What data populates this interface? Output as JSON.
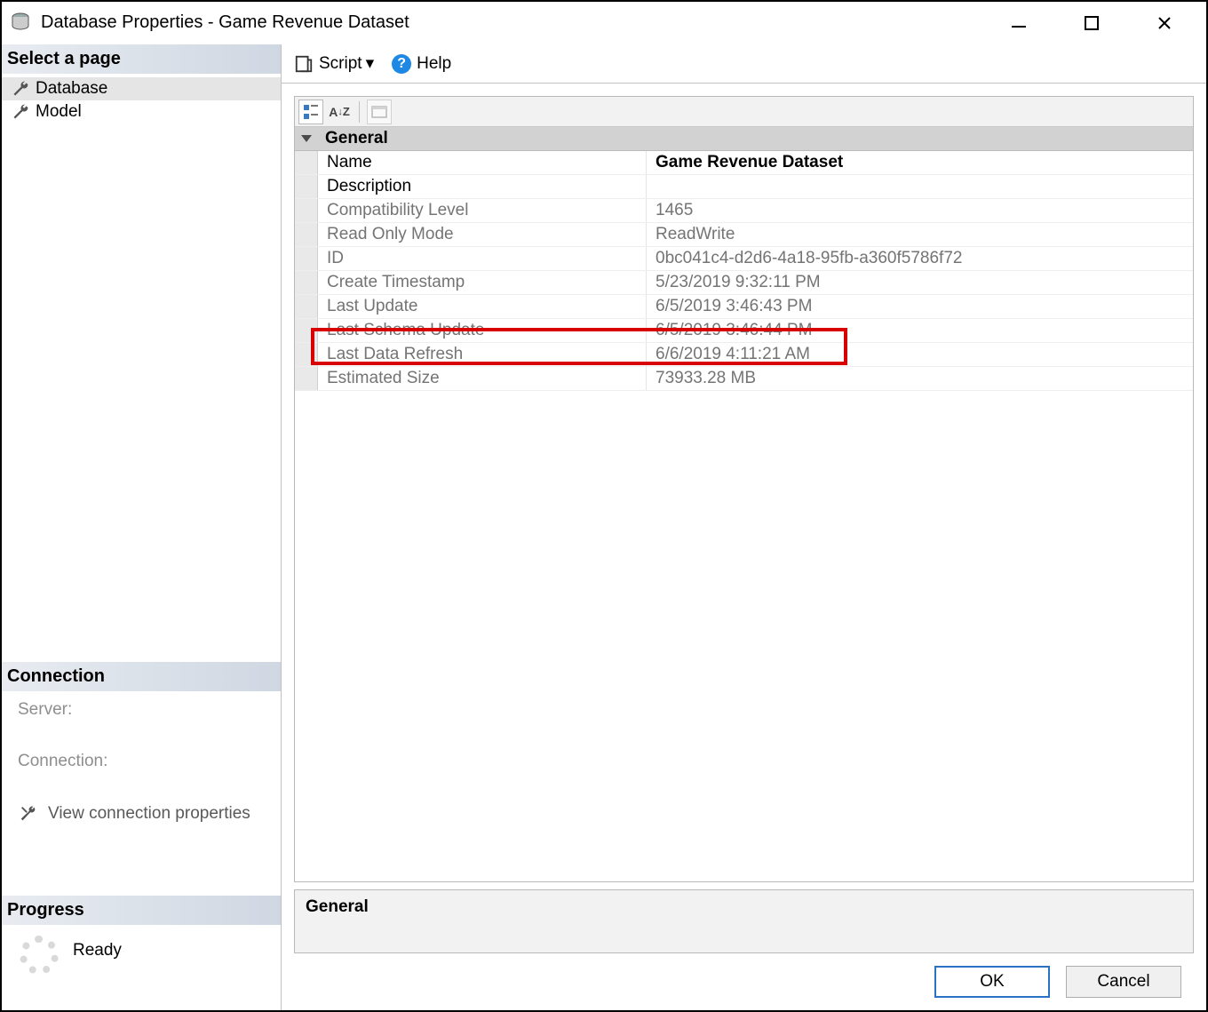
{
  "titlebar": {
    "title": "Database Properties - Game Revenue Dataset"
  },
  "sidebar": {
    "select_page_header": "Select a page",
    "pages": [
      {
        "label": "Database",
        "selected": true
      },
      {
        "label": "Model",
        "selected": false
      }
    ],
    "connection_header": "Connection",
    "server_label": "Server:",
    "connection_label": "Connection:",
    "view_conn_props": "View connection properties",
    "progress_header": "Progress",
    "progress_status": "Ready"
  },
  "toolbar": {
    "script_label": "Script",
    "help_label": "Help"
  },
  "property_grid": {
    "group_general": "General",
    "rows": [
      {
        "label": "Name",
        "value": "Game Revenue Dataset",
        "readonly": false,
        "bold": true
      },
      {
        "label": "Description",
        "value": "",
        "readonly": false,
        "bold": false
      },
      {
        "label": "Compatibility Level",
        "value": "1465",
        "readonly": true,
        "bold": false
      },
      {
        "label": "Read Only Mode",
        "value": "ReadWrite",
        "readonly": true,
        "bold": false
      },
      {
        "label": "ID",
        "value": "0bc041c4-d2d6-4a18-95fb-a360f5786f72",
        "readonly": true,
        "bold": false
      },
      {
        "label": "Create Timestamp",
        "value": "5/23/2019 9:32:11 PM",
        "readonly": true,
        "bold": false
      },
      {
        "label": "Last Update",
        "value": "6/5/2019 3:46:43 PM",
        "readonly": true,
        "bold": false
      },
      {
        "label": "Last Schema Update",
        "value": "6/5/2019 3:46:44 PM",
        "readonly": true,
        "bold": false
      },
      {
        "label": "Last Data Refresh",
        "value": "6/6/2019 4:11:21 AM",
        "readonly": true,
        "bold": false
      },
      {
        "label": "Estimated Size",
        "value": "73933.28 MB",
        "readonly": true,
        "bold": false
      }
    ],
    "description_header": "General"
  },
  "footer": {
    "ok": "OK",
    "cancel": "Cancel"
  }
}
